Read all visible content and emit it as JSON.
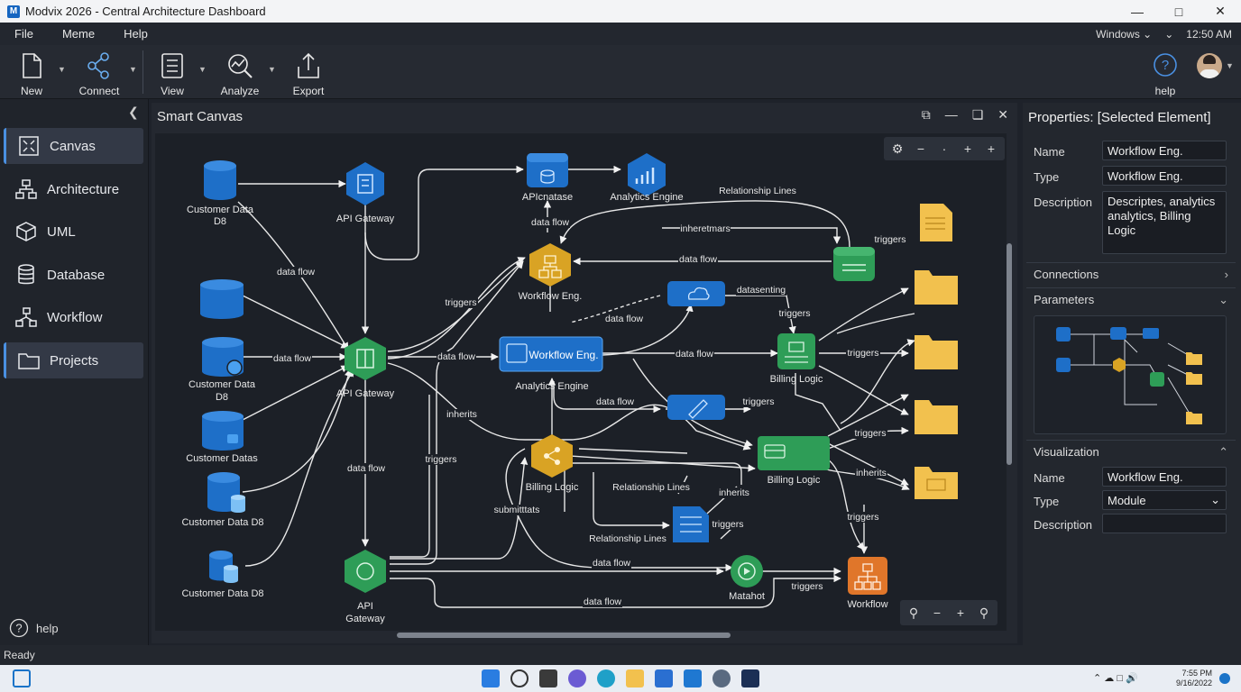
{
  "window": {
    "title": "Modvix 2026 - Central Architecture Dashboard",
    "logo": "M"
  },
  "menu": {
    "items": [
      "File",
      "Meme",
      "Help"
    ],
    "windows_label": "Windows",
    "time": "12:50 AM"
  },
  "toolbar": {
    "new": "New",
    "connect": "Connect",
    "view": "View",
    "analyze": "Analyze",
    "export": "Export",
    "help": "help"
  },
  "sidebar": {
    "items": [
      {
        "label": "Canvas",
        "icon": "canvas-icon"
      },
      {
        "label": "Architecture",
        "icon": "architecture-icon"
      },
      {
        "label": "UML",
        "icon": "cube-icon"
      },
      {
        "label": "Database",
        "icon": "database-icon"
      },
      {
        "label": "Workflow",
        "icon": "workflow-icon"
      },
      {
        "label": "Projects",
        "icon": "folder-icon"
      }
    ],
    "help": "help"
  },
  "canvas": {
    "title": "Smart Canvas",
    "nodes": {
      "cust1": "Customer Data",
      "cust1b": "D8",
      "apigw1": "API Gateway",
      "apidb": "APIcnatase",
      "analytics1": "Analytics Engine",
      "workflow1": "Workflow Eng.",
      "cust3": "Customer Data",
      "cust3b": "D8",
      "apigw2": "API Gateway",
      "wfbox": "Workflow Eng.",
      "analytics2": "Analytics Engine",
      "billing1": "Billing Logic",
      "cust4": "Customer Datas",
      "billing2": "Billing Logic",
      "billing3": "Billing Logic",
      "cust5": "Customer Data D8",
      "cust6": "Customer Data D8",
      "apigw3a": "API",
      "apigw3b": "Gateway",
      "matahot": "Matahot",
      "workflow2": "Workflow"
    },
    "edge_labels": {
      "df1": "data flow",
      "df2": "data flow",
      "df3": "data flow",
      "df4": "data flow",
      "df5": "data flow",
      "df6": "data flow",
      "df7": "data flow",
      "df8": "data flow",
      "df9": "data flow",
      "df10": "data flow",
      "df11": "data flow",
      "rel1": "Relationship Lines",
      "inher1": "inheretmars",
      "trig1": "triggers",
      "trig2": "triggers",
      "trig3": "triggers",
      "trig4": "triggers",
      "trig5": "triggers",
      "trig6": "triggers",
      "trig7": "triggers",
      "trig8": "triggers",
      "trig9": "triggers",
      "trig10": "triggers",
      "datasent": "datasenting",
      "inherits1": "inherits",
      "inherits2": "inherits",
      "inherits3": "inherits",
      "rel2": "Relationship Lines",
      "rel3": "Relationship Lines",
      "submit": "submitttats"
    }
  },
  "properties": {
    "title": "Properties: [Selected Element]",
    "name_label": "Name",
    "name_value": "Workflow Eng.",
    "type_label": "Type",
    "type_value": "Workflow Eng.",
    "desc_label": "Description",
    "desc_value": "Descriptes, analytics analytics, Billing Logic",
    "connections": "Connections",
    "parameters": "Parameters",
    "visualization": "Visualization",
    "vis_name_label": "Name",
    "vis_name_value": "Workflow Eng.",
    "vis_type_label": "Type",
    "vis_type_value": "Module",
    "vis_desc_label": "Description",
    "vis_desc_value": ""
  },
  "status": {
    "text": "Ready"
  },
  "taskbar": {
    "time": "7:55 PM",
    "date": "9/16/2022"
  },
  "colors": {
    "blue_node": "#1e6fc8",
    "green_node": "#2e9d57",
    "gold_node": "#d9a324",
    "orange_node": "#e0762a",
    "folder": "#f2c14e",
    "accent": "#4a90e2"
  }
}
